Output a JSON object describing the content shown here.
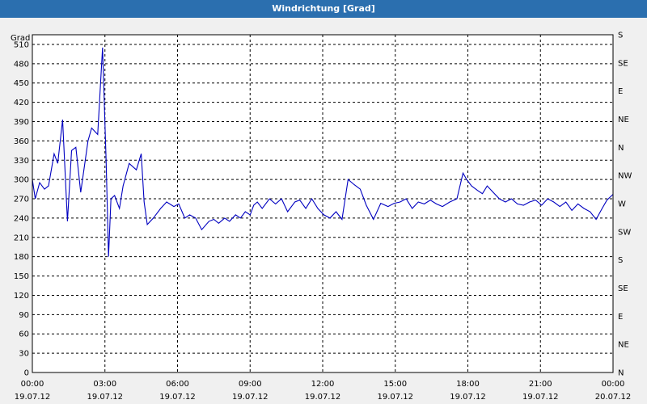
{
  "window": {
    "title": "Windrichtung [Grad]"
  },
  "colors": {
    "title_bar": "#2b6faf",
    "series": "#0000c0",
    "grid": "#000000",
    "background": "#ffffff"
  },
  "chart_data": {
    "type": "line",
    "title": "Windrichtung [Grad]",
    "ylabel": "Grad",
    "xlabel": "",
    "x_unit": "hours",
    "xlim": [
      0,
      24
    ],
    "ylim": [
      0,
      525
    ],
    "grid": true,
    "grid_style": "dashed",
    "x_ticks": [
      {
        "value": 0,
        "time": "00:00",
        "date": "19.07.12"
      },
      {
        "value": 3,
        "time": "03:00",
        "date": "19.07.12"
      },
      {
        "value": 6,
        "time": "06:00",
        "date": "19.07.12"
      },
      {
        "value": 9,
        "time": "09:00",
        "date": "19.07.12"
      },
      {
        "value": 12,
        "time": "12:00",
        "date": "19.07.12"
      },
      {
        "value": 15,
        "time": "15:00",
        "date": "19.07.12"
      },
      {
        "value": 18,
        "time": "18:00",
        "date": "19.07.12"
      },
      {
        "value": 21,
        "time": "21:00",
        "date": "19.07.12"
      },
      {
        "value": 24,
        "time": "00:00",
        "date": "20.07.12"
      }
    ],
    "y_ticks": [
      0,
      30,
      60,
      90,
      120,
      150,
      180,
      210,
      240,
      270,
      300,
      330,
      360,
      390,
      420,
      450,
      480,
      510
    ],
    "y2_ticks": [
      {
        "value": 0,
        "label": "N"
      },
      {
        "value": 45,
        "label": "NE"
      },
      {
        "value": 90,
        "label": "E"
      },
      {
        "value": 135,
        "label": "SE"
      },
      {
        "value": 180,
        "label": "S"
      },
      {
        "value": 225,
        "label": "SW"
      },
      {
        "value": 270,
        "label": "W"
      },
      {
        "value": 315,
        "label": "NW"
      },
      {
        "value": 360,
        "label": "N"
      },
      {
        "value": 405,
        "label": "NE"
      },
      {
        "value": 450,
        "label": "E"
      },
      {
        "value": 495,
        "label": "SE"
      },
      {
        "value": 540,
        "label": "S"
      }
    ],
    "series": [
      {
        "x": [
          0.0,
          0.12,
          0.3,
          0.5,
          0.67,
          0.9,
          1.05,
          1.25,
          1.45,
          1.62,
          1.8,
          2.0,
          2.3,
          2.45,
          2.7,
          2.9,
          3.05,
          3.15,
          3.25,
          3.4,
          3.6,
          3.75,
          4.0,
          4.3,
          4.5,
          4.62,
          4.75,
          5.0,
          5.3,
          5.55,
          5.85,
          6.05,
          6.3,
          6.5,
          6.75,
          7.0,
          7.3,
          7.5,
          7.7,
          7.95,
          8.15,
          8.4,
          8.6,
          8.8,
          9.0,
          9.15,
          9.3,
          9.5,
          9.8,
          10.05,
          10.3,
          10.55,
          10.85,
          11.05,
          11.3,
          11.55,
          11.8,
          12.05,
          12.3,
          12.55,
          12.8,
          13.05,
          13.3,
          13.55,
          13.8,
          14.1,
          14.4,
          14.7,
          14.95,
          15.2,
          15.45,
          15.7,
          15.95,
          16.2,
          16.45,
          16.7,
          16.95,
          17.25,
          17.55,
          17.8,
          17.95,
          18.15,
          18.4,
          18.6,
          18.8,
          19.05,
          19.3,
          19.55,
          19.8,
          20.05,
          20.3,
          20.55,
          20.8,
          21.05,
          21.3,
          21.55,
          21.8,
          22.05,
          22.3,
          22.55,
          22.8,
          23.05,
          23.3,
          23.55,
          23.75,
          24.0
        ],
        "y": [
          300,
          270,
          295,
          285,
          290,
          340,
          325,
          393,
          235,
          345,
          350,
          280,
          360,
          380,
          370,
          505,
          330,
          180,
          270,
          275,
          255,
          290,
          325,
          315,
          340,
          265,
          230,
          240,
          255,
          265,
          258,
          262,
          240,
          245,
          240,
          222,
          235,
          238,
          232,
          240,
          235,
          245,
          240,
          250,
          245,
          260,
          265,
          255,
          270,
          262,
          270,
          250,
          265,
          268,
          255,
          270,
          255,
          245,
          240,
          250,
          238,
          300,
          292,
          285,
          260,
          238,
          263,
          258,
          263,
          265,
          270,
          255,
          265,
          262,
          268,
          262,
          258,
          265,
          270,
          310,
          300,
          290,
          283,
          278,
          290,
          280,
          270,
          265,
          270,
          262,
          260,
          265,
          268,
          260,
          270,
          265,
          258,
          265,
          252,
          262,
          255,
          250,
          238,
          255,
          268,
          277
        ]
      }
    ]
  }
}
